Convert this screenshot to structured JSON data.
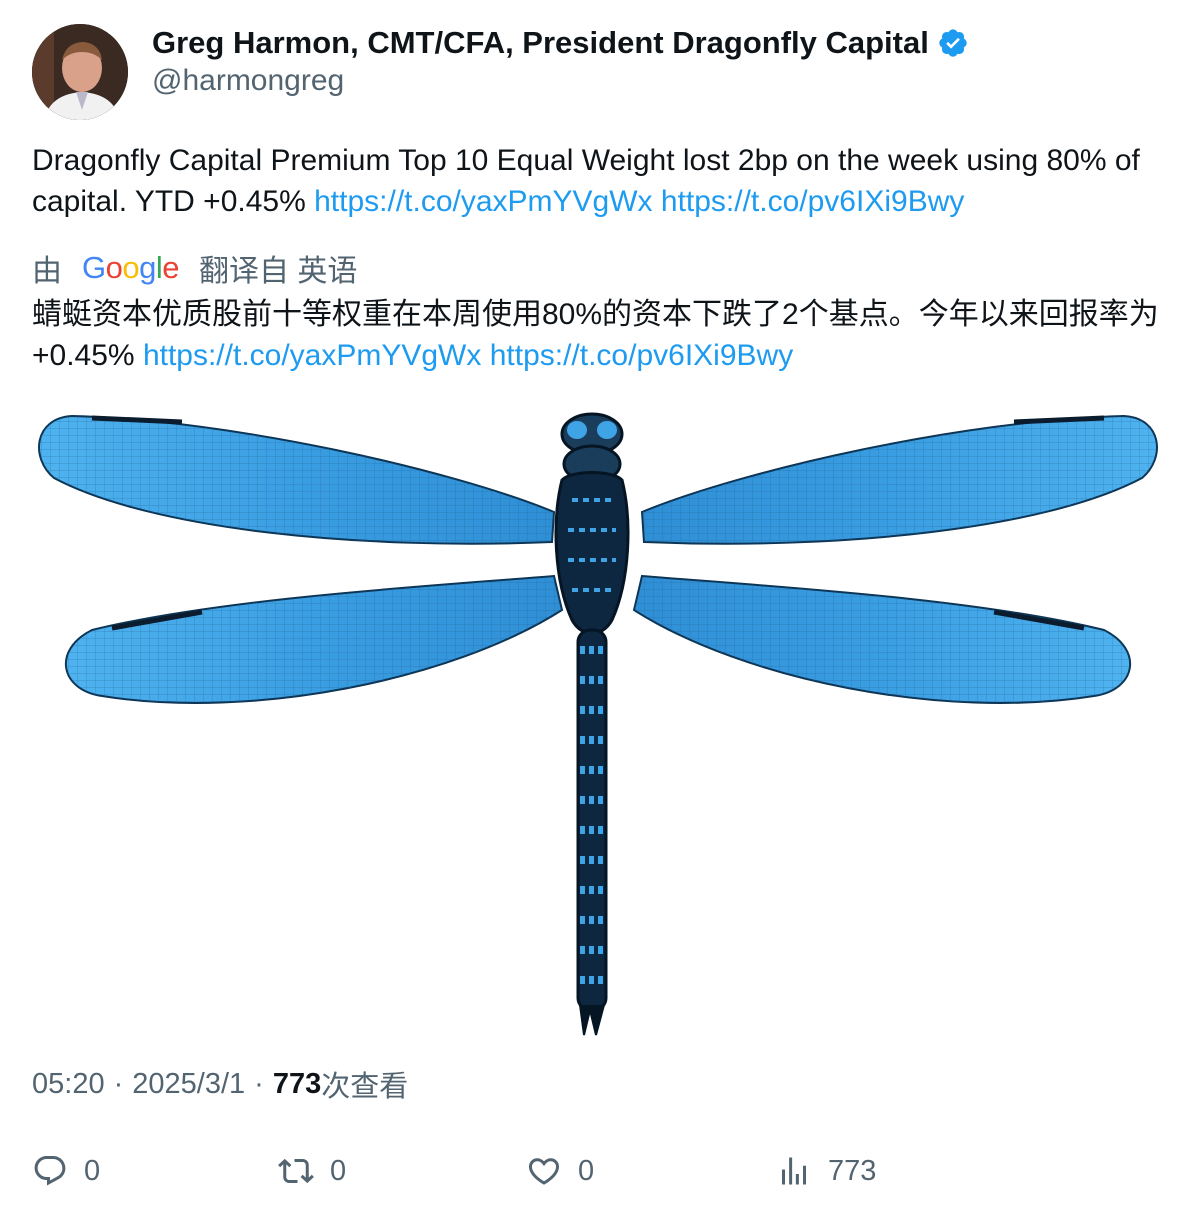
{
  "author": {
    "display_name": "Greg Harmon, CMT/CFA, President Dragonfly Capital",
    "handle": "@harmongreg",
    "verified_color": "#1d9bf0"
  },
  "tweet": {
    "text": "Dragonfly Capital Premium Top 10 Equal Weight lost 2bp on the week using 80% of capital.  YTD +0.45%",
    "link1": "https://t.co/yaxPmYVgWx",
    "link2": "https://t.co/pv6IXi9Bwy"
  },
  "translation": {
    "prefix": "由",
    "provider": "Google",
    "suffix": "翻译自 英语",
    "text": "蜻蜓资本优质股前十等权重在本周使用80%的资本下跌了2个基点。今年以来回报率为+0.45%",
    "link1": "https://t.co/yaxPmYVgWx",
    "link2": "https://t.co/pv6IXi9Bwy"
  },
  "meta": {
    "time": "05:20",
    "separator": "·",
    "date": "2025/3/1",
    "views": "773",
    "views_label": "次查看"
  },
  "actions": {
    "replies": "0",
    "retweets": "0",
    "likes": "0",
    "views": "773"
  },
  "colors": {
    "link": "#1d9bf0",
    "secondary": "#536471",
    "wing": "#3fa4e6"
  }
}
